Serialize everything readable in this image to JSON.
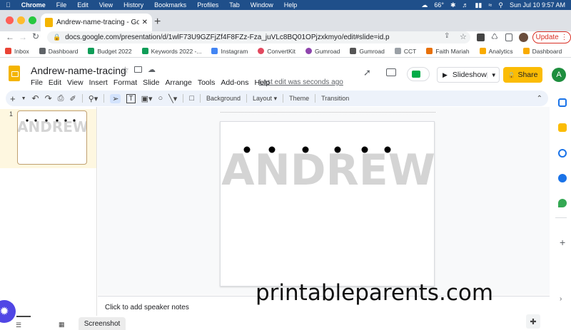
{
  "mac_menu": {
    "app": "Chrome",
    "items": [
      "File",
      "Edit",
      "View",
      "History",
      "Bookmarks",
      "Profiles",
      "Tab",
      "Window",
      "Help"
    ],
    "weather": "66°",
    "clock": "Sun Jul 10  9:57 AM"
  },
  "browser": {
    "tab_title": "Andrew-name-tracing - Google",
    "url": "docs.google.com/presentation/d/1wlF73U9GZFjZf4F8FZz-Fza_juVLc8BQ01OPjzxkmyo/edit#slide=id.p",
    "update_label": "Update",
    "bookmarks": [
      {
        "label": "Inbox",
        "icon": "gmail-icon",
        "color": "#ea4335"
      },
      {
        "label": "Dashboard",
        "icon": "dashboard-icon",
        "color": "#5f6368"
      },
      {
        "label": "Budget 2022",
        "icon": "sheets-icon",
        "color": "#0f9d58"
      },
      {
        "label": "Keywords 2022 -...",
        "icon": "sheets-icon",
        "color": "#0f9d58"
      },
      {
        "label": "Instagram",
        "icon": "docs-icon",
        "color": "#4285f4"
      },
      {
        "label": "ConvertKit",
        "icon": "convertkit-icon",
        "color": "#e2495f"
      },
      {
        "label": "Gumroad",
        "icon": "gumroad-icon",
        "color": "#8e44ad"
      },
      {
        "label": "Gumroad",
        "icon": "gumroad-icon",
        "color": "#555555"
      },
      {
        "label": "CCT",
        "icon": "cct-icon",
        "color": "#9aa0a6"
      },
      {
        "label": "Faith Mariah",
        "icon": "faith-icon",
        "color": "#e8710a"
      },
      {
        "label": "Analytics",
        "icon": "analytics-icon",
        "color": "#f9ab00"
      },
      {
        "label": "Dashboard",
        "icon": "analytics-icon",
        "color": "#f9ab00"
      }
    ]
  },
  "docs": {
    "title": "Andrew-name-tracing",
    "menus": [
      "File",
      "Edit",
      "View",
      "Insert",
      "Format",
      "Slide",
      "Arrange",
      "Tools",
      "Add-ons",
      "Help"
    ],
    "last_edit": "Last edit was seconds ago",
    "slideshow_label": "Slideshow",
    "share_label": "Share",
    "avatar_letter": "A",
    "toolbar": {
      "background": "Background",
      "layout": "Layout",
      "theme": "Theme",
      "transition": "Transition"
    },
    "slide_number": "1",
    "slide_word": "ANDREW",
    "notes_placeholder": "Click to add speaker notes",
    "bottom_tab": "Screenshot"
  },
  "watermark": "printableparents.com",
  "colors": {
    "accent": "#fbbc04",
    "slide_letters": "#d4d4d4",
    "dots": "#000000"
  }
}
